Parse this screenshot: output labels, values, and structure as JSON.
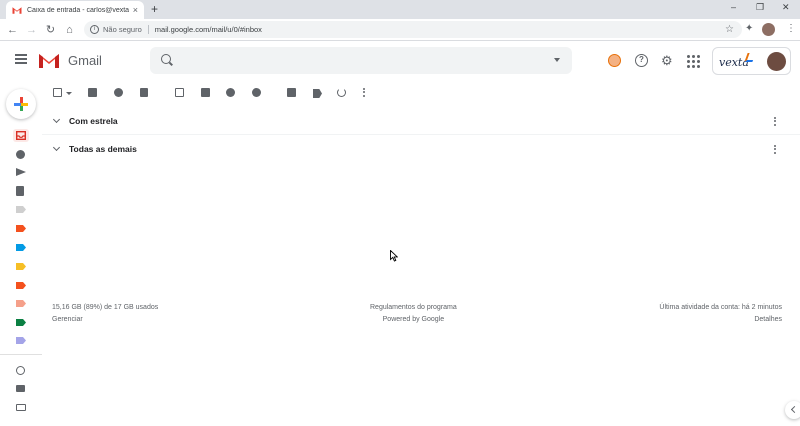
{
  "browser": {
    "tab_title": "Caixa de entrada - carlos@vexta...",
    "tab_close": "×",
    "new_tab": "+",
    "window_controls": [
      "–",
      "❐",
      "✕"
    ],
    "nav": {
      "back": "←",
      "forward": "→",
      "reload": "↻",
      "home": "⌂"
    },
    "security_label": "Não seguro",
    "url": "mail.google.com/mail/u/0/#inbox",
    "star": "☆",
    "extensions": "✦",
    "menu": "⋮"
  },
  "gmail": {
    "logo_text": "Gmail",
    "account_brand": "vexta"
  },
  "sections": [
    {
      "title": "Com estrela"
    },
    {
      "title": "Todas as demais"
    }
  ],
  "footer": {
    "storage": "15,16 GB (89%) de 17 GB usados",
    "manage": "Gerenciar",
    "program_policies": "Regulamentos do programa",
    "powered_by": "Powered by Google",
    "last_activity": "Última atividade da conta: há 2 minutos",
    "details": "Detalhes"
  },
  "colors": {
    "gmail_red": "#ea4335",
    "label_gray": "#cfcfcf",
    "label_orange": "#f4511e",
    "label_blue": "#039be5",
    "label_yellow": "#f6bf26",
    "label_salmon": "#f5a08a",
    "label_green": "#0b8043",
    "label_lavender": "#a4a4e8"
  }
}
